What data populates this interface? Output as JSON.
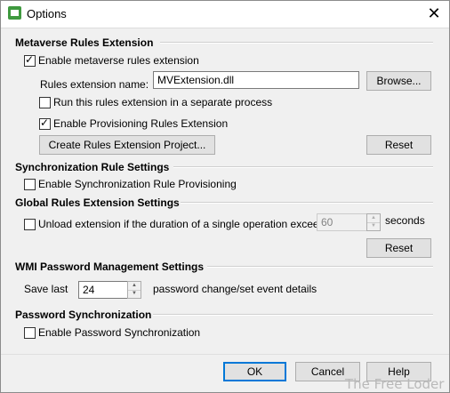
{
  "window": {
    "title": "Options"
  },
  "metaverse": {
    "header": "Metaverse Rules Extension",
    "enable_label": "Enable metaverse rules extension",
    "enable_checked": true,
    "name_label": "Rules extension name:",
    "name_value": "MVExtension.dll",
    "browse_label": "Browse...",
    "separate_label": "Run this rules extension in a separate process",
    "separate_checked": false,
    "provisioning_label": "Enable Provisioning Rules Extension",
    "provisioning_checked": true,
    "create_project_label": "Create Rules Extension Project...",
    "reset_label": "Reset"
  },
  "sync_rule": {
    "header": "Synchronization Rule Settings",
    "enable_label": "Enable Synchronization Rule Provisioning",
    "enable_checked": false
  },
  "global_rules": {
    "header": "Global Rules Extension Settings",
    "unload_label": "Unload extension if the duration of a single operation exceeds:",
    "unload_checked": false,
    "timeout_value": "60",
    "seconds_label": "seconds",
    "reset_label": "Reset"
  },
  "wmi": {
    "header": "WMI Password Management Settings",
    "save_last_label": "Save last",
    "save_last_value": "24",
    "details_label": "password change/set event details"
  },
  "password_sync": {
    "header": "Password Synchronization",
    "enable_label": "Enable Password Synchronization",
    "enable_checked": false
  },
  "footer": {
    "ok_label": "OK",
    "cancel_label": "Cancel",
    "help_label": "Help"
  },
  "watermark": "The Free Loder",
  "colors": {
    "accent": "#0078d7",
    "icon_green": "#3f9a3f"
  },
  "icons": {
    "app": "options-app-icon",
    "close": "close-icon"
  }
}
